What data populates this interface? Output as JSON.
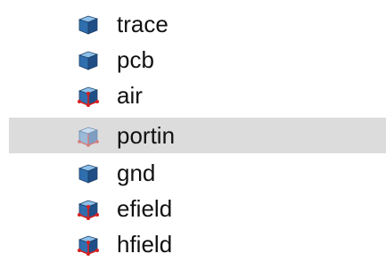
{
  "tree": {
    "items": [
      {
        "label": "trace",
        "icon": "solid-box-icon",
        "selected": false
      },
      {
        "label": "pcb",
        "icon": "solid-box-icon",
        "selected": false
      },
      {
        "label": "air",
        "icon": "boundary-box-icon",
        "selected": false
      },
      {
        "label": "portin",
        "icon": "port-box-icon",
        "selected": true
      },
      {
        "label": "gnd",
        "icon": "solid-box-icon",
        "selected": false
      },
      {
        "label": "efield",
        "icon": "boundary-box-icon",
        "selected": false
      },
      {
        "label": "hfield",
        "icon": "boundary-box-icon",
        "selected": false
      }
    ]
  },
  "colors": {
    "selection_bg": "#dcdcdc",
    "box_face_front": "#2f6fb0",
    "box_face_top": "#7fb3e0",
    "box_face_side": "#1f4f86",
    "boundary_marker": "#d62020",
    "port_box_front": "#9bbad8"
  }
}
